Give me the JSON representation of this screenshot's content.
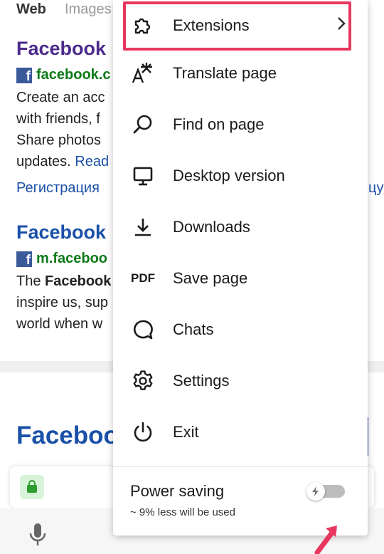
{
  "background": {
    "tabs": {
      "web": "Web",
      "images": "Images"
    },
    "result1": {
      "title": "Facebook",
      "url": "facebook.c",
      "snippet_lines": [
        "Create an acc",
        "with friends, f",
        "Share photos",
        "updates."
      ],
      "read_more": "Read",
      "sitelink": "Регистрация",
      "sitelink_right": "цу"
    },
    "result2": {
      "title": "Facebook",
      "url": "m.faceboo",
      "snippet_bold": "Facebook",
      "snippet_line1_prefix": "The ",
      "snippet_lines": [
        "inspire us, sup",
        "world when w"
      ]
    },
    "result3": {
      "title": "Facebook"
    },
    "fb_icon": "f"
  },
  "menu": {
    "items": [
      {
        "label": "Extensions",
        "icon": "puzzle-icon"
      },
      {
        "label": "Translate page",
        "icon": "translate-icon"
      },
      {
        "label": "Find on page",
        "icon": "search-icon"
      },
      {
        "label": "Desktop version",
        "icon": "monitor-icon"
      },
      {
        "label": "Downloads",
        "icon": "download-icon"
      },
      {
        "label": "Save page",
        "icon": "pdf-icon",
        "icon_text": "PDF"
      },
      {
        "label": "Chats",
        "icon": "chat-icon"
      },
      {
        "label": "Settings",
        "icon": "gear-icon"
      },
      {
        "label": "Exit",
        "icon": "power-icon"
      }
    ],
    "power_saving": {
      "label": "Power saving",
      "sublabel": "~ 9% less will be used",
      "enabled": false
    }
  },
  "colors": {
    "highlight": "#e8375f",
    "title_visited": "#4c2a8c",
    "link_blue": "#1a50a8",
    "url_green": "#0a7a17"
  }
}
